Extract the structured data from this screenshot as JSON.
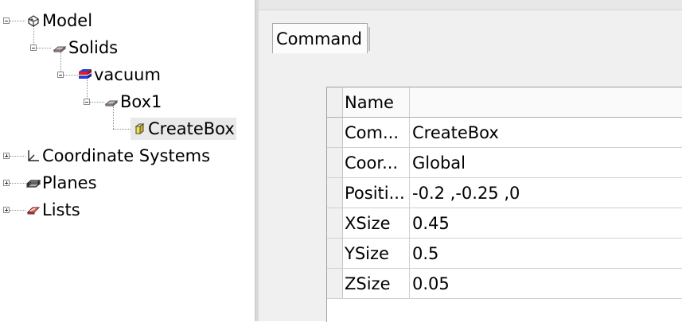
{
  "tree": {
    "model": "Model",
    "solids": "Solids",
    "vacuum": "vacuum",
    "box1": "Box1",
    "createbox": "CreateBox",
    "coordinate_systems": "Coordinate Systems",
    "planes": "Planes",
    "lists": "Lists"
  },
  "tab": {
    "label": "Command"
  },
  "grid": {
    "header": "Name",
    "rows": [
      {
        "name": "Com...",
        "value": "CreateBox"
      },
      {
        "name": "Coor...",
        "value": "Global"
      },
      {
        "name": "Positi...",
        "value": "-0.2 ,-0.25 ,0"
      },
      {
        "name": "XSize",
        "value": "0.45"
      },
      {
        "name": "YSize",
        "value": "0.5"
      },
      {
        "name": "ZSize",
        "value": "0.05"
      }
    ]
  },
  "icons": [
    "model-icon",
    "solid-icon",
    "material-icon",
    "box-icon",
    "create-box-icon",
    "coordinate-system-icon",
    "plane-icon",
    "list-icon"
  ]
}
